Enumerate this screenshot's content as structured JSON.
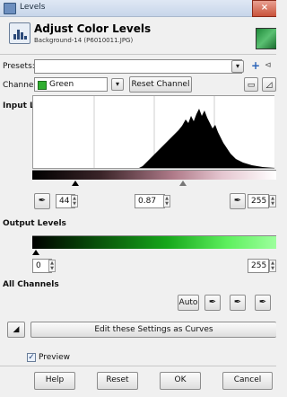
{
  "window": {
    "title": "Levels",
    "close_glyph": "×"
  },
  "header": {
    "title": "Adjust Color Levels",
    "subtitle": "Background-14 (P6010011.JPG)"
  },
  "presets": {
    "label": "Presets:",
    "value": ""
  },
  "channel": {
    "label": "Channel:",
    "value": "Green",
    "reset_label": "Reset Channel",
    "color": "#2fae2f"
  },
  "input_levels": {
    "label": "Input Levels",
    "low": "44",
    "gamma": "0.87",
    "high": "255"
  },
  "output_levels": {
    "label": "Output Levels",
    "low": "0",
    "high": "255"
  },
  "all_channels": {
    "label": "All Channels",
    "auto_label": "Auto"
  },
  "curves": {
    "label": "Edit these Settings as Curves"
  },
  "preview": {
    "label": "Preview",
    "checked": true
  },
  "buttons": {
    "help": "Help",
    "reset": "Reset",
    "ok": "OK",
    "cancel": "Cancel"
  }
}
